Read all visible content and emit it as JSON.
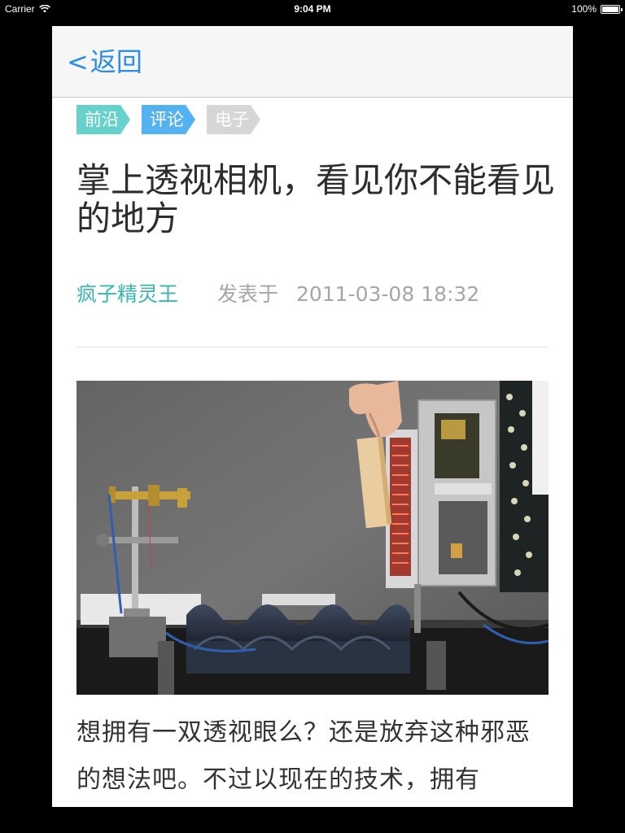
{
  "status_bar": {
    "carrier": "Carrier",
    "time": "9:04 PM",
    "battery": "100%"
  },
  "nav": {
    "back_chevron": "<",
    "back_label": "返回"
  },
  "tags": [
    {
      "label": "前沿",
      "color": "#67d2cb"
    },
    {
      "label": "评论",
      "color": "#55b2f0"
    },
    {
      "label": "电子",
      "color": "#d6d6d6"
    }
  ],
  "article": {
    "title": "掌上透视相机，看见你不能看见的地方",
    "author": "疯子精灵王",
    "posted_label": "发表于",
    "date": "2011-03-08 18:32",
    "body": "想拥有一双透视眼么？还是放弃这种邪恶的想法吧。不过以现在的技术，拥有"
  },
  "colors": {
    "link": "#2b8de6",
    "author": "#3bb4b0",
    "meta": "#a6a6a6",
    "text": "#333333"
  }
}
